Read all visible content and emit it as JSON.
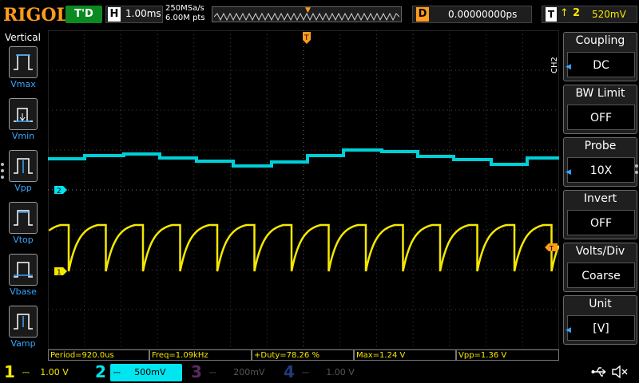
{
  "header": {
    "brand": "RIGOL",
    "run_status": "T'D",
    "timebase_label": "H",
    "timebase": "1.00ms",
    "sample_rate": "250MSa/s",
    "memory_depth": "6.00M pts",
    "delay_label": "D",
    "delay": "0.00000000ps",
    "trigger_label": "T",
    "trigger_edge": "↑",
    "trigger_source": "2",
    "trigger_level": "520mV"
  },
  "left_panel": {
    "title": "Vertical",
    "items": [
      {
        "label": "Vmax"
      },
      {
        "label": "Vmin"
      },
      {
        "label": "Vpp"
      },
      {
        "label": "Vtop"
      },
      {
        "label": "Vbase"
      },
      {
        "label": "Vamp"
      }
    ]
  },
  "right_menu": {
    "channel_tag": "CH2",
    "items": [
      {
        "title": "Coupling",
        "value": "DC"
      },
      {
        "title": "BW Limit",
        "value": "OFF"
      },
      {
        "title": "Probe",
        "value": "10X"
      },
      {
        "title": "Invert",
        "value": "OFF"
      },
      {
        "title": "Volts/Div",
        "value": "Coarse"
      },
      {
        "title": "Unit",
        "value": "[V]"
      }
    ]
  },
  "markers": {
    "ch2": "2",
    "ch1": "1",
    "trigger_top": "T",
    "trigger_right": "T"
  },
  "measurements": [
    "Period=920.0us",
    "Freq=1.09kHz",
    "+Duty=78.26 %",
    "Max=1.24 V",
    "Vpp=1.36 V"
  ],
  "channels": [
    {
      "num": "1",
      "scale": "1.00 V",
      "color": "#f5e800",
      "active": false
    },
    {
      "num": "2",
      "scale": "500mV",
      "color": "#00e5ef",
      "active": true
    },
    {
      "num": "3",
      "scale": "200mV",
      "color": "#d138d8",
      "active": false
    },
    {
      "num": "4",
      "scale": "1.00 V",
      "color": "#2b6fff",
      "active": false
    }
  ],
  "colors": {
    "ch1": "#f5e800",
    "ch2": "#00e5ef",
    "accent": "#ff9b1f",
    "grid": "#444444"
  }
}
